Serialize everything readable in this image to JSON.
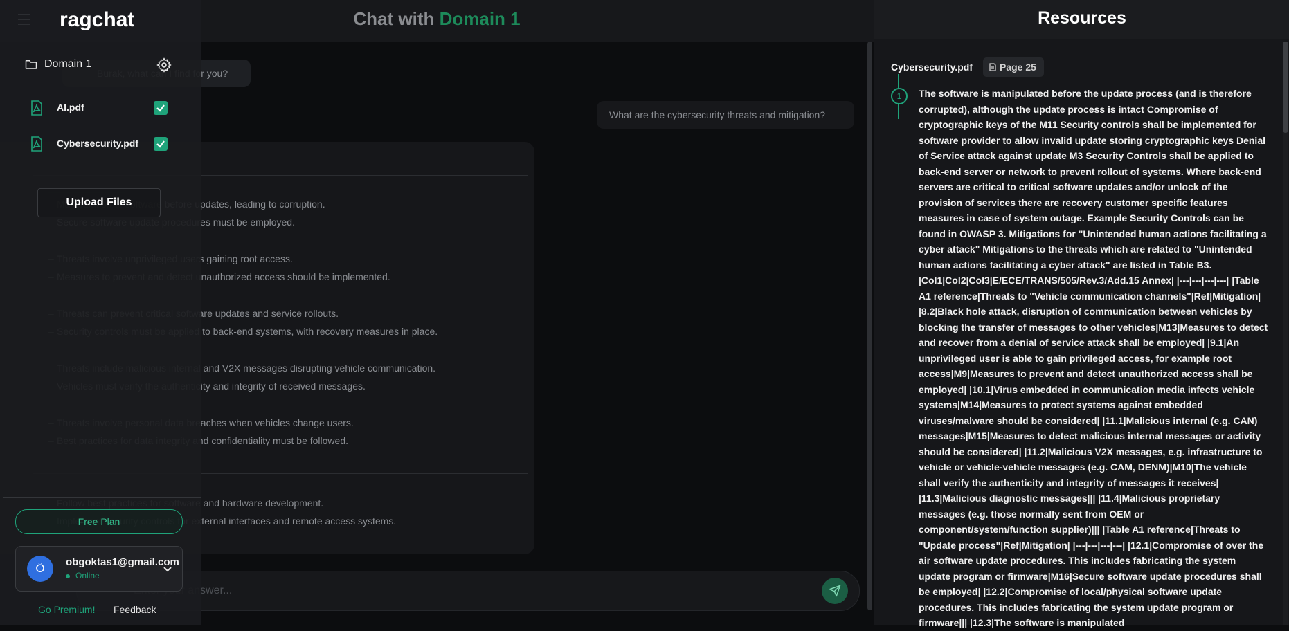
{
  "chat": {
    "title_prefix": "Chat with ",
    "title_domain": "Domain 1",
    "greeting_text": "Burak, what can I find for you?",
    "user_question": "What are the cybersecurity threats and mitigation?",
    "answer_lines": [
      "Manipulation of software before updates, leading to corruption.",
      "Secure software update procedures must be employed.",
      "Threats involve unprivileged users gaining root access.",
      "Measures to prevent and detect unauthorized access should be implemented.",
      "Threats can prevent critical software updates and service rollouts.",
      "Security controls must be applied to back-end systems, with recovery measures in place.",
      "Threats include malicious internal and V2X messages disrupting vehicle communication.",
      "Vehicles must verify the authenticity and integrity of received messages.",
      "Threats involve personal data breaches when vehicles change users.",
      "Best practices for data integrity and confidentiality must be followed.",
      "Follow best practices for software and hardware development.",
      "Implement security controls for external interfaces and remote access systems."
    ],
    "input_placeholder": "Enter your answer..."
  },
  "sidebar": {
    "brand": "ragchat",
    "domain_label": "Domain 1",
    "files": [
      {
        "name": "AI.pdf",
        "checked": true
      },
      {
        "name": "Cybersecurity.pdf",
        "checked": true
      }
    ],
    "upload_label": "Upload Files",
    "plan_label": "Free Plan",
    "user": {
      "avatar_initial": "Ö",
      "email": "obgoktas1@gmail.com",
      "status": "Online"
    },
    "premium_label": "Go Premium!",
    "feedback_label": "Feedback"
  },
  "resources": {
    "title": "Resources",
    "file_name": "Cybersecurity.pdf",
    "page_label": "Page 25",
    "ref_number": "1",
    "ref_text": "The software is manipulated before the update process (and is therefore corrupted), although the update process is intact Compromise of cryptographic keys of the M11 Security controls shall be implemented for software provider to allow invalid update storing cryptographic keys Denial of Service attack against update M3 Security Controls shall be applied to back-end server or network to prevent rollout of systems. Where back-end servers are critical to critical software updates and/or unlock of the provision of services there are recovery customer specific features measures in case of system outage. Example Security Controls can be found in OWASP 3. Mitigations for \"Unintended human actions facilitating a cyber attack\" Mitigations to the threats which are related to \"Unintended human actions facilitating a cyber attack\" are listed in Table B3. |Col1|Col2|Col3|E/ECE/TRANS/505/Rev.3/Add.15 Annex| |---|---|---|---| |Table A1 reference|Threats to \"Vehicle communication channels\"|Ref|Mitigation| |8.2|Black hole attack, disruption of communication between vehicles by blocking the transfer of messages to other vehicles|M13|Measures to detect and recover from a denial of service attack shall be employed| |9.1|An unprivileged user is able to gain privileged access, for example root access|M9|Measures to prevent and detect unauthorized access shall be employed| |10.1|Virus embedded in communication media infects vehicle systems|M14|Measures to protect systems against embedded viruses/malware should be considered| |11.1|Malicious internal (e.g. CAN) messages|M15|Measures to detect malicious internal messages or activity should be considered| |11.2|Malicious V2X messages, e.g. infrastructure to vehicle or vehicle-vehicle messages (e.g. CAM, DENM)|M10|The vehicle shall verify the authenticity and integrity of messages it receives| |11.3|Malicious diagnostic messages||| |11.4|Malicious proprietary messages (e.g. those normally sent from OEM or component/system/function supplier)||| |Table A1 reference|Threats to \"Update process\"|Ref|Mitigation| |---|---|---|---| |12.1|Compromise of over the air software update procedures. This includes fabricating the system update program or firmware|M16|Secure software update procedures shall be employed| |12.2|Compromise of local/physical software update procedures. This includes fabricating the system update program or firmware||| |12.3|The software is manipulated"
  },
  "colors": {
    "accent": "#1fa37a",
    "title_accent": "#1d8a5a",
    "background": "#0c0d0f",
    "panel": "#16171a",
    "sidebar": "#1b1c1f",
    "avatar": "#2f6fe0"
  },
  "icons": [
    "menu-icon",
    "folder-icon",
    "settings-icon",
    "pdf-icon",
    "checkbox-icon",
    "chevron-down-icon",
    "send-icon",
    "document-icon"
  ]
}
